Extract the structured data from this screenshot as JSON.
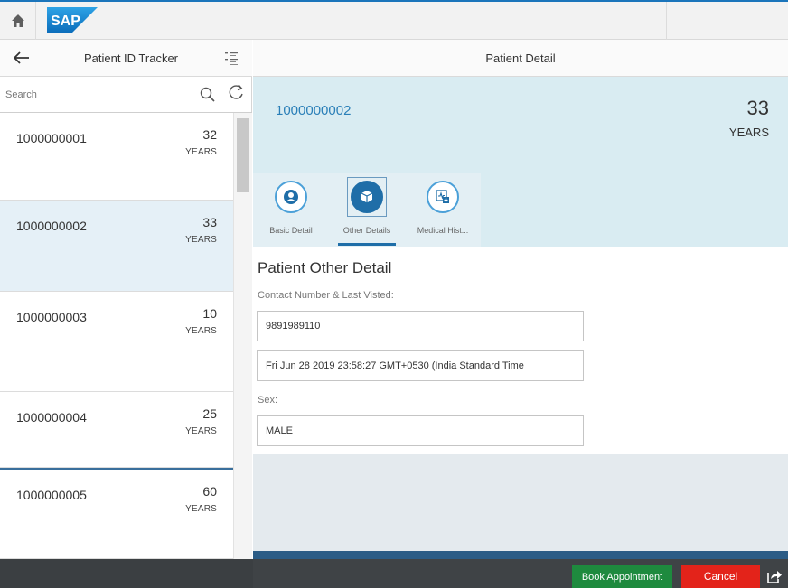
{
  "shellbar": {
    "logo_text": "SAP",
    "home_icon": "home-icon"
  },
  "master": {
    "title": "Patient ID Tracker",
    "back_icon": "arrow-left-icon",
    "list_icon": "list-view-icon",
    "search": {
      "placeholder": "Search",
      "value": ""
    },
    "items": [
      {
        "id": "1000000001",
        "age": "32",
        "unit": "YEARS"
      },
      {
        "id": "1000000002",
        "age": "33",
        "unit": "YEARS"
      },
      {
        "id": "1000000003",
        "age": "10",
        "unit": "YEARS"
      },
      {
        "id": "1000000004",
        "age": "25",
        "unit": "YEARS"
      },
      {
        "id": "1000000005",
        "age": "60",
        "unit": "YEARS"
      }
    ],
    "selected_index": 1
  },
  "detail": {
    "title": "Patient Detail",
    "object": {
      "id": "1000000002",
      "age": "33",
      "unit": "YEARS"
    },
    "tabs": [
      {
        "label": "Basic Detail",
        "icon": "person-icon"
      },
      {
        "label": "Other Details",
        "icon": "box-icon"
      },
      {
        "label": "Medical Hist...",
        "icon": "medical-record-icon"
      }
    ],
    "active_tab": 1,
    "form": {
      "title": "Patient Other Detail",
      "contact_label": "Contact Number & Last Visted:",
      "phone": "9891989110",
      "last_visited": "Fri Jun 28 2019 23:58:27 GMT+0530 (India Standard Time",
      "sex_label": "Sex:",
      "sex": "MALE"
    }
  },
  "footer": {
    "book_label": "Book Appointment",
    "cancel_label": "Cancel",
    "share_icon": "share-icon"
  },
  "colors": {
    "accent": "#1b75bb",
    "header_bg": "#d9ecf2",
    "selected_row": "#e5f0f7",
    "book": "#1e8a3e",
    "cancel": "#e3231a",
    "footer": "#3f4346"
  }
}
